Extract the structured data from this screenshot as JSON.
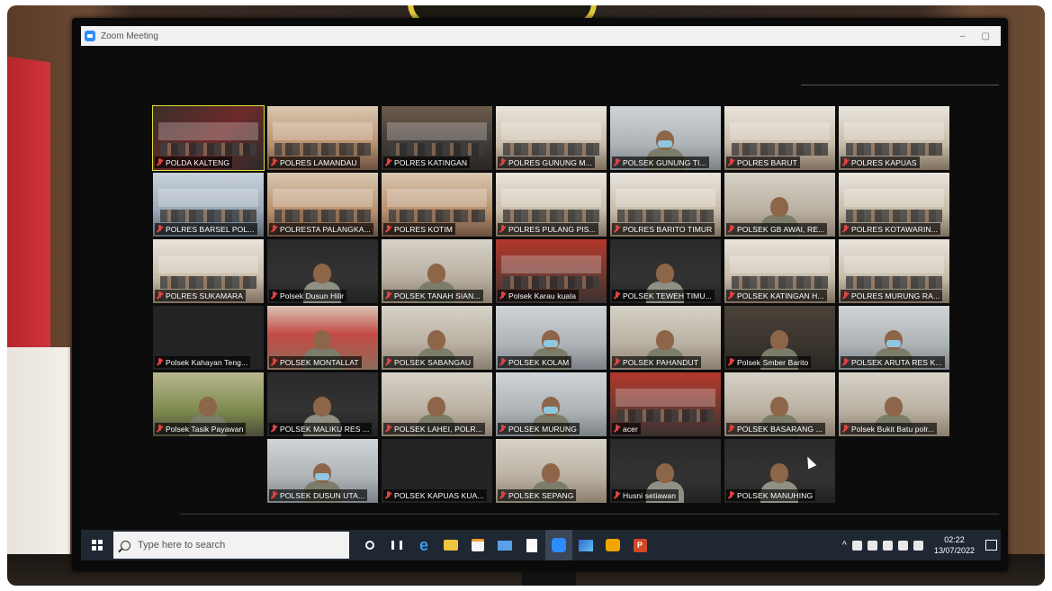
{
  "window": {
    "title": "Zoom Meeting",
    "minimize_glyph": "–",
    "maximize_glyph": "▢"
  },
  "participants": [
    {
      "name": "POLDA KALTENG",
      "scene": "dark",
      "active": true
    },
    {
      "name": "POLRES LAMANDAU",
      "scene": "room-warm"
    },
    {
      "name": "POLRES KATINGAN",
      "scene": "room-dark"
    },
    {
      "name": "POLRES GUNUNG M...",
      "scene": "room-light"
    },
    {
      "name": "POLSEK GUNUNG TI...",
      "scene": "face-mask"
    },
    {
      "name": "POLRES BARUT",
      "scene": "room-light"
    },
    {
      "name": "POLRES KAPUAS",
      "scene": "room-light"
    },
    {
      "name": "POLRES BARSEL POL...",
      "scene": "room-blue"
    },
    {
      "name": "POLRESTA PALANGKA...",
      "scene": "room-warm"
    },
    {
      "name": "POLRES KOTIM",
      "scene": "room-warm"
    },
    {
      "name": "POLRES PULANG PIS...",
      "scene": "room-light"
    },
    {
      "name": "POLRES BARITO TIMUR",
      "scene": "room-light"
    },
    {
      "name": "POLSEK GB AWAI, RE...",
      "scene": "face"
    },
    {
      "name": "POLRES KOTAWARIN...",
      "scene": "room-light"
    },
    {
      "name": "POLRES SUKAMARA",
      "scene": "room-light"
    },
    {
      "name": "Polsek Dusun Hilir",
      "scene": "dark-person"
    },
    {
      "name": "POLSEK TANAH SIAN...",
      "scene": "face"
    },
    {
      "name": "Polsek Karau kuala",
      "scene": "room-red"
    },
    {
      "name": "POLSEK TEWEH TIMU...",
      "scene": "dark-person"
    },
    {
      "name": "POLSEK KATINGAN H...",
      "scene": "room-light"
    },
    {
      "name": "POLRES MURUNG RA...",
      "scene": "room-light"
    },
    {
      "name": "Polsek Kahayan Teng...",
      "scene": "black"
    },
    {
      "name": "POLSEK MONTALLAT",
      "scene": "face-red"
    },
    {
      "name": "POLSEK SABANGAU",
      "scene": "face"
    },
    {
      "name": "POLSEK KOLAM",
      "scene": "face-mask"
    },
    {
      "name": "POLSEK PAHANDUT",
      "scene": "face"
    },
    {
      "name": "Polsek Smber Barito",
      "scene": "face-dark"
    },
    {
      "name": "POLSEK ARUTA RES K...",
      "scene": "face-mask"
    },
    {
      "name": "Polsek Tasik Payawan",
      "scene": "face-green"
    },
    {
      "name": "POLSEK MALIKU RES ...",
      "scene": "dark-person"
    },
    {
      "name": "POLSEK LAHEI, POLR...",
      "scene": "face"
    },
    {
      "name": "POLSEK MURUNG",
      "scene": "face-mask"
    },
    {
      "name": "acer",
      "scene": "room-red"
    },
    {
      "name": "POLSEK BASARANG ...",
      "scene": "face"
    },
    {
      "name": "Polsek Bukit Batu polr...",
      "scene": "face"
    },
    {
      "name": "POLSEK DUSUN UTA...",
      "scene": "face-mask"
    },
    {
      "name": "POLSEK KAPUAS KUA...",
      "scene": "black"
    },
    {
      "name": "POLSEK SEPANG",
      "scene": "face"
    },
    {
      "name": "Husni setiawan",
      "scene": "dark-person"
    },
    {
      "name": "POLSEK MANUHING",
      "scene": "dark-person"
    }
  ],
  "grid_rows": [
    [
      0,
      7
    ],
    [
      7,
      14
    ],
    [
      14,
      21
    ],
    [
      21,
      28
    ],
    [
      28,
      35
    ],
    [
      35,
      40
    ]
  ],
  "taskbar": {
    "search_placeholder": "Type here to search",
    "time": "02:22",
    "date": "13/07/2022",
    "ppt_letter": "P",
    "tray_chevron": "^",
    "edge_letter": "e"
  },
  "colors": {
    "active_speaker": "#e2e230",
    "muted_mic": "#e04242",
    "zoom_blue": "#2d8cff",
    "taskbar": "#1f2733"
  }
}
